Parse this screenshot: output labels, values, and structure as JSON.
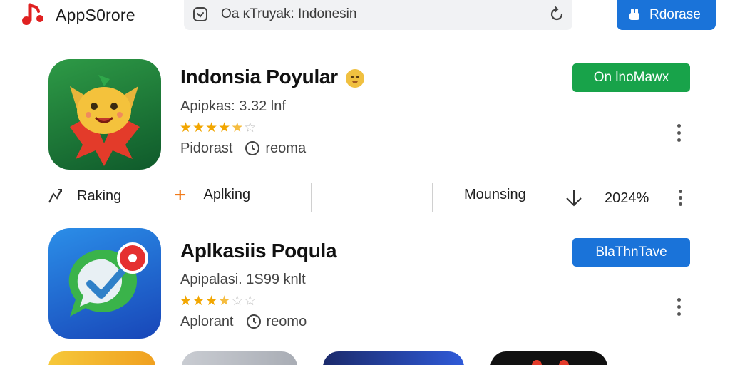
{
  "header": {
    "brand_name": "AppS0rore",
    "search_text": "Oa ĸTruyak: Indonesin",
    "top_button_label": "Rdorase"
  },
  "apps": [
    {
      "title": "Indonsia Poyular",
      "subtitle": "Apipkas: 3.32 lnf",
      "rating": 4.5,
      "meta_label": "Pidorast",
      "meta_value": "reoma",
      "action_label": "On lnoMawx",
      "action_color": "#18a34a",
      "icon_name": "smiling-leaf-creature-icon"
    },
    {
      "title": "Aplkasiis Poqula",
      "subtitle": "Apipalasi. 1S99 knlt",
      "rating": 3.5,
      "meta_label": "Aplorant",
      "meta_value": "reomo",
      "action_label": "BlaThnTave",
      "action_color": "#1a73d9",
      "icon_name": "chat-checkmark-icon"
    }
  ],
  "stats": {
    "ranking_label": "Raking",
    "apps_label": "Aplking",
    "trending_label": "Mounsing",
    "percent_label": "2024%"
  },
  "colors": {
    "accent_blue": "#1a73d9",
    "accent_green": "#18a34a",
    "star": "#f2a600",
    "logo_red": "#e02020"
  }
}
